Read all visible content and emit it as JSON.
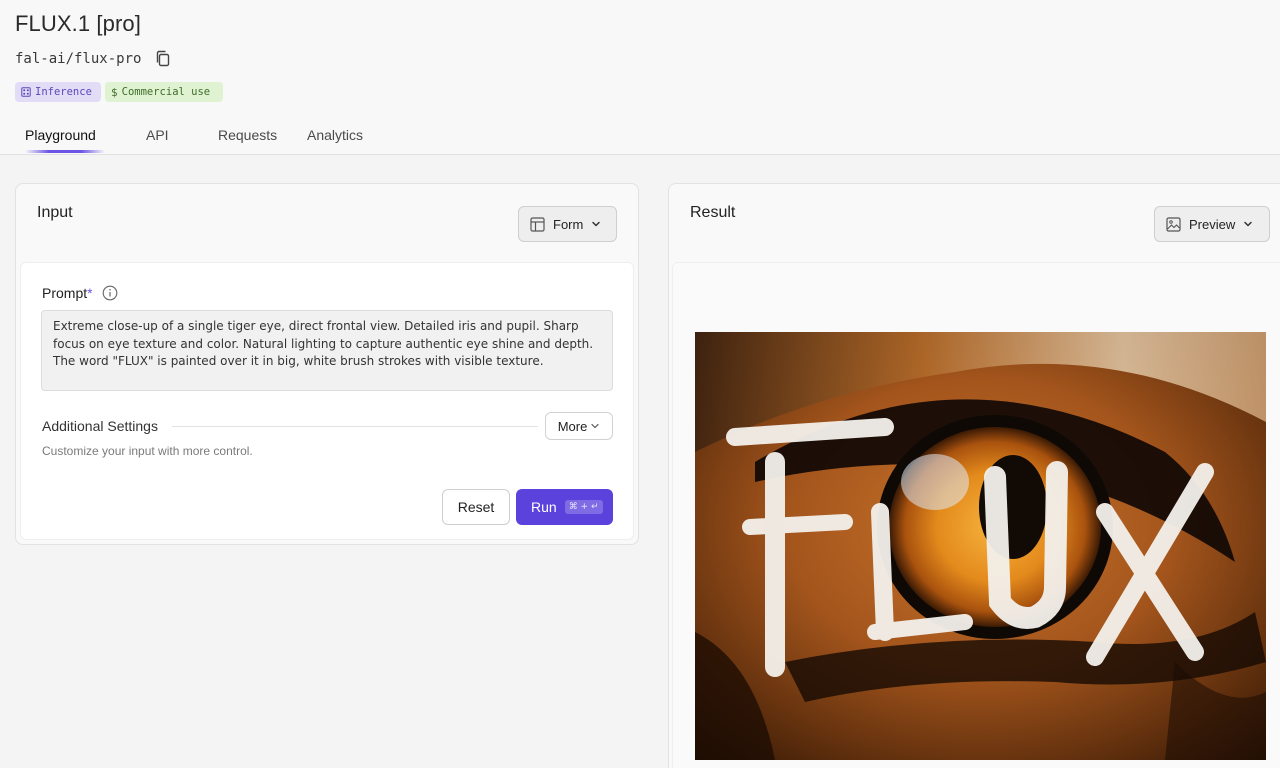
{
  "header": {
    "title": "FLUX.1 [pro]",
    "model_id": "fal-ai/flux-pro",
    "badges": [
      {
        "icon": "inference-icon",
        "label": "Inference"
      },
      {
        "icon": "dollar-icon",
        "label": "Commercial use"
      }
    ],
    "tabs": [
      {
        "label": "Playground",
        "active": true
      },
      {
        "label": "API",
        "active": false
      },
      {
        "label": "Requests",
        "active": false
      },
      {
        "label": "Analytics",
        "active": false
      }
    ]
  },
  "input_panel": {
    "title": "Input",
    "view_selector": "Form",
    "prompt": {
      "label": "Prompt",
      "required_mark": "*",
      "value": "Extreme close-up of a single tiger eye, direct frontal view. Detailed iris and pupil. Sharp focus on eye texture and color. Natural lighting to capture authentic eye shine and depth. The word \"FLUX\" is painted over it in big, white brush strokes with visible texture."
    },
    "additional_settings": {
      "title": "Additional Settings",
      "more_label": "More",
      "description": "Customize your input with more control."
    },
    "reset_label": "Reset",
    "run_label": "Run",
    "run_shortcut": "⌘ + ↵"
  },
  "result_panel": {
    "title": "Result",
    "view_selector": "Preview",
    "image_text": "FLUX"
  },
  "colors": {
    "accent": "#5b42dc",
    "inference_badge_bg": "#e2dcf7",
    "commercial_badge_bg": "#dff2d2"
  }
}
